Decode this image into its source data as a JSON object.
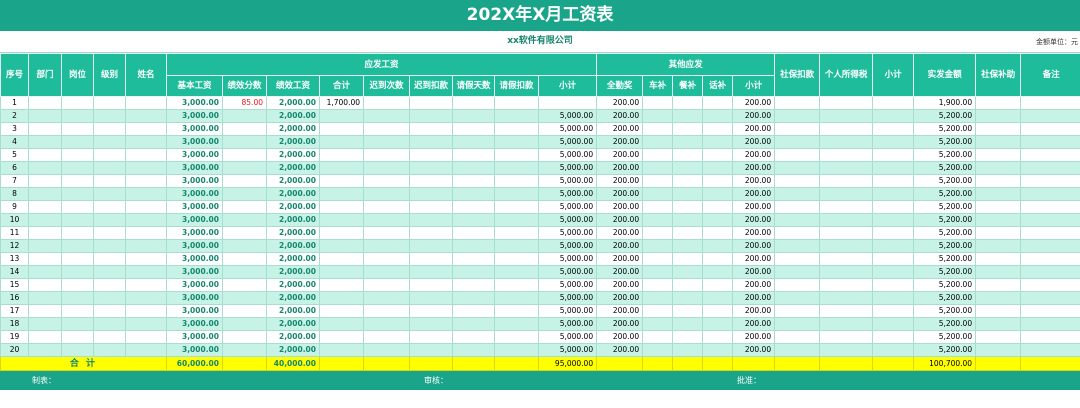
{
  "title": "202X年X月工资表",
  "company": "xx软件有限公司",
  "unit_label": "金额单位：元",
  "headers": {
    "seq": "序号",
    "dept": "部门",
    "post": "岗位",
    "level": "级别",
    "name": "姓名",
    "payable_group": "应发工资",
    "base": "基本工资",
    "perf_score": "绩效分数",
    "perf_pay": "绩效工资",
    "total": "合计",
    "late_count": "迟到次数",
    "late_deduct": "迟到扣款",
    "leave_days": "请假天数",
    "leave_deduct": "请假扣款",
    "subtotal1": "小计",
    "other_group": "其他应发",
    "attendance": "全勤奖",
    "car": "车补",
    "meal": "餐补",
    "phone": "话补",
    "subtotal2": "小计",
    "social_deduct": "社保扣款",
    "income_tax": "个人所得税",
    "subtotal3": "小计",
    "net_pay": "实发金额",
    "social_subsidy": "社保补助",
    "remark": "备注"
  },
  "rows": [
    {
      "seq": "1",
      "base": "3,000.00",
      "perf_score": "85.00",
      "perf_pay": "2,000.00",
      "total": "1,700.00",
      "subtotal1": "",
      "attendance": "200.00",
      "subtotal2": "200.00",
      "net_pay": "1,900.00"
    },
    {
      "seq": "2",
      "base": "3,000.00",
      "perf_score": "",
      "perf_pay": "2,000.00",
      "total": "",
      "subtotal1": "5,000.00",
      "attendance": "200.00",
      "subtotal2": "200.00",
      "net_pay": "5,200.00"
    },
    {
      "seq": "3",
      "base": "3,000.00",
      "perf_score": "",
      "perf_pay": "2,000.00",
      "total": "",
      "subtotal1": "5,000.00",
      "attendance": "200.00",
      "subtotal2": "200.00",
      "net_pay": "5,200.00"
    },
    {
      "seq": "4",
      "base": "3,000.00",
      "perf_score": "",
      "perf_pay": "2,000.00",
      "total": "",
      "subtotal1": "5,000.00",
      "attendance": "200.00",
      "subtotal2": "200.00",
      "net_pay": "5,200.00"
    },
    {
      "seq": "5",
      "base": "3,000.00",
      "perf_score": "",
      "perf_pay": "2,000.00",
      "total": "",
      "subtotal1": "5,000.00",
      "attendance": "200.00",
      "subtotal2": "200.00",
      "net_pay": "5,200.00"
    },
    {
      "seq": "6",
      "base": "3,000.00",
      "perf_score": "",
      "perf_pay": "2,000.00",
      "total": "",
      "subtotal1": "5,000.00",
      "attendance": "200.00",
      "subtotal2": "200.00",
      "net_pay": "5,200.00"
    },
    {
      "seq": "7",
      "base": "3,000.00",
      "perf_score": "",
      "perf_pay": "2,000.00",
      "total": "",
      "subtotal1": "5,000.00",
      "attendance": "200.00",
      "subtotal2": "200.00",
      "net_pay": "5,200.00"
    },
    {
      "seq": "8",
      "base": "3,000.00",
      "perf_score": "",
      "perf_pay": "2,000.00",
      "total": "",
      "subtotal1": "5,000.00",
      "attendance": "200.00",
      "subtotal2": "200.00",
      "net_pay": "5,200.00"
    },
    {
      "seq": "9",
      "base": "3,000.00",
      "perf_score": "",
      "perf_pay": "2,000.00",
      "total": "",
      "subtotal1": "5,000.00",
      "attendance": "200.00",
      "subtotal2": "200.00",
      "net_pay": "5,200.00"
    },
    {
      "seq": "10",
      "base": "3,000.00",
      "perf_score": "",
      "perf_pay": "2,000.00",
      "total": "",
      "subtotal1": "5,000.00",
      "attendance": "200.00",
      "subtotal2": "200.00",
      "net_pay": "5,200.00"
    },
    {
      "seq": "11",
      "base": "3,000.00",
      "perf_score": "",
      "perf_pay": "2,000.00",
      "total": "",
      "subtotal1": "5,000.00",
      "attendance": "200.00",
      "subtotal2": "200.00",
      "net_pay": "5,200.00"
    },
    {
      "seq": "12",
      "base": "3,000.00",
      "perf_score": "",
      "perf_pay": "2,000.00",
      "total": "",
      "subtotal1": "5,000.00",
      "attendance": "200.00",
      "subtotal2": "200.00",
      "net_pay": "5,200.00"
    },
    {
      "seq": "13",
      "base": "3,000.00",
      "perf_score": "",
      "perf_pay": "2,000.00",
      "total": "",
      "subtotal1": "5,000.00",
      "attendance": "200.00",
      "subtotal2": "200.00",
      "net_pay": "5,200.00"
    },
    {
      "seq": "14",
      "base": "3,000.00",
      "perf_score": "",
      "perf_pay": "2,000.00",
      "total": "",
      "subtotal1": "5,000.00",
      "attendance": "200.00",
      "subtotal2": "200.00",
      "net_pay": "5,200.00"
    },
    {
      "seq": "15",
      "base": "3,000.00",
      "perf_score": "",
      "perf_pay": "2,000.00",
      "total": "",
      "subtotal1": "5,000.00",
      "attendance": "200.00",
      "subtotal2": "200.00",
      "net_pay": "5,200.00"
    },
    {
      "seq": "16",
      "base": "3,000.00",
      "perf_score": "",
      "perf_pay": "2,000.00",
      "total": "",
      "subtotal1": "5,000.00",
      "attendance": "200.00",
      "subtotal2": "200.00",
      "net_pay": "5,200.00"
    },
    {
      "seq": "17",
      "base": "3,000.00",
      "perf_score": "",
      "perf_pay": "2,000.00",
      "total": "",
      "subtotal1": "5,000.00",
      "attendance": "200.00",
      "subtotal2": "200.00",
      "net_pay": "5,200.00"
    },
    {
      "seq": "18",
      "base": "3,000.00",
      "perf_score": "",
      "perf_pay": "2,000.00",
      "total": "",
      "subtotal1": "5,000.00",
      "attendance": "200.00",
      "subtotal2": "200.00",
      "net_pay": "5,200.00"
    },
    {
      "seq": "19",
      "base": "3,000.00",
      "perf_score": "",
      "perf_pay": "2,000.00",
      "total": "",
      "subtotal1": "5,000.00",
      "attendance": "200.00",
      "subtotal2": "200.00",
      "net_pay": "5,200.00"
    },
    {
      "seq": "20",
      "base": "3,000.00",
      "perf_score": "",
      "perf_pay": "2,000.00",
      "total": "",
      "subtotal1": "5,000.00",
      "attendance": "200.00",
      "subtotal2": "200.00",
      "net_pay": "5,200.00"
    }
  ],
  "totals": {
    "label": "合 计",
    "base": "60,000.00",
    "perf_pay": "40,000.00",
    "subtotal1": "95,000.00",
    "net_pay": "100,700.00"
  },
  "footer": {
    "prepared_by": "制表：",
    "reviewed_by": "审核：",
    "approved_by": "批准："
  },
  "colors": {
    "header_green": "#1fbc9c",
    "title_green": "#1aa58a",
    "stripe_mint": "#c6f3e6",
    "total_yellow": "#ffff00",
    "value_green": "#16866f",
    "score_red": "#e0191e"
  }
}
